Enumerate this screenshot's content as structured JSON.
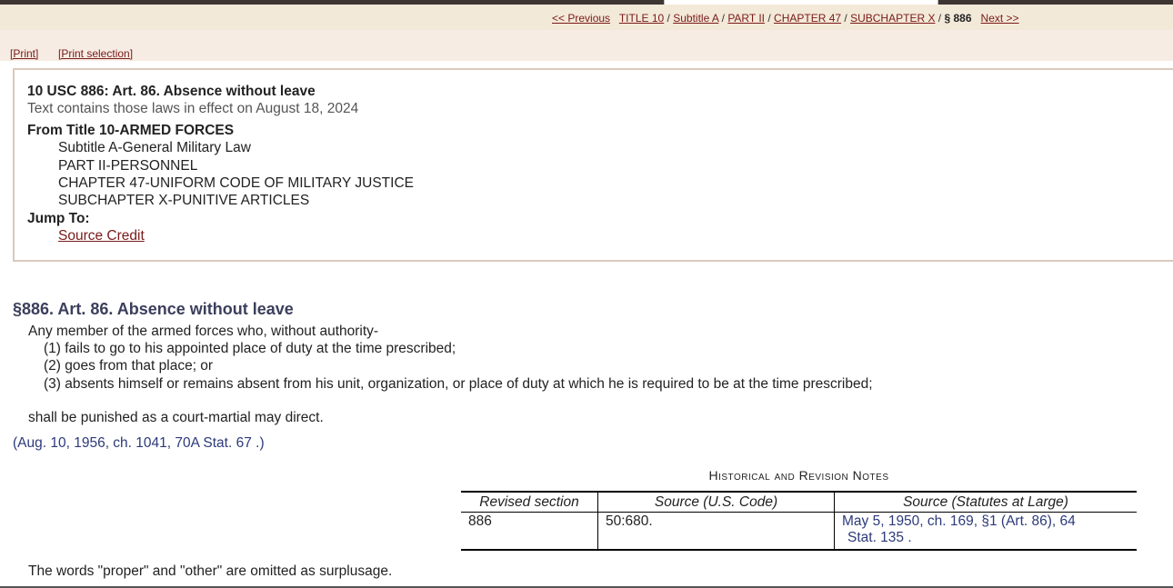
{
  "nav": {
    "previous": "<< Previous",
    "title": "TITLE 10",
    "subtitle": "Subtitle A",
    "part": "PART II",
    "chapter": "CHAPTER 47",
    "subchapter": "SUBCHAPTER X",
    "current": "§ 886",
    "next": "Next >>",
    "sep": "/"
  },
  "print": {
    "print_label": "[Print]",
    "print_selection_label": "[Print selection]"
  },
  "header": {
    "citation": "10 USC 886: Art. 86. Absence without leave",
    "effective": "Text contains those laws in effect on August 18, 2024",
    "from_title": "From Title 10-ARMED FORCES",
    "hierarchy": [
      "Subtitle A-General Military Law",
      "PART II-PERSONNEL",
      "CHAPTER 47-UNIFORM CODE OF MILITARY JUSTICE",
      "SUBCHAPTER X-PUNITIVE ARTICLES"
    ],
    "jump_to": "Jump To:",
    "source_credit_link": "Source Credit"
  },
  "section": {
    "title": "§886. Art. 86. Absence without leave",
    "intro": "Any member of the armed forces who, without authority-",
    "items": [
      "(1) fails to go to his appointed place of duty at the time prescribed;",
      "(2) goes from that place; or",
      "(3) absents himself or remains absent from his unit, organization, or place of duty at which he is required to be at the time prescribed;"
    ],
    "closing": "shall be punished as a court-martial may direct.",
    "credit": "(Aug. 10, 1956, ch. 1041, 70A Stat. 67 .)"
  },
  "notes": {
    "heading": "Historical and Revision Notes",
    "columns": [
      "Revised section",
      "Source (U.S. Code)",
      "Source (Statutes at Large)"
    ],
    "rows": [
      {
        "revised": "886",
        "usc": "50:680.",
        "statutes_line1": "May 5, 1950, ch. 169, §1 (Art. 86), 64",
        "statutes_line2": "Stat. 135 ."
      }
    ],
    "text": "The words \"proper\" and \"other\" are omitted as surplusage."
  },
  "colors": {
    "link": "#7a1a1a",
    "nav_bg": "#f3e9d8",
    "credit": "#2d3a7a",
    "box_border": "#d9cabd"
  }
}
